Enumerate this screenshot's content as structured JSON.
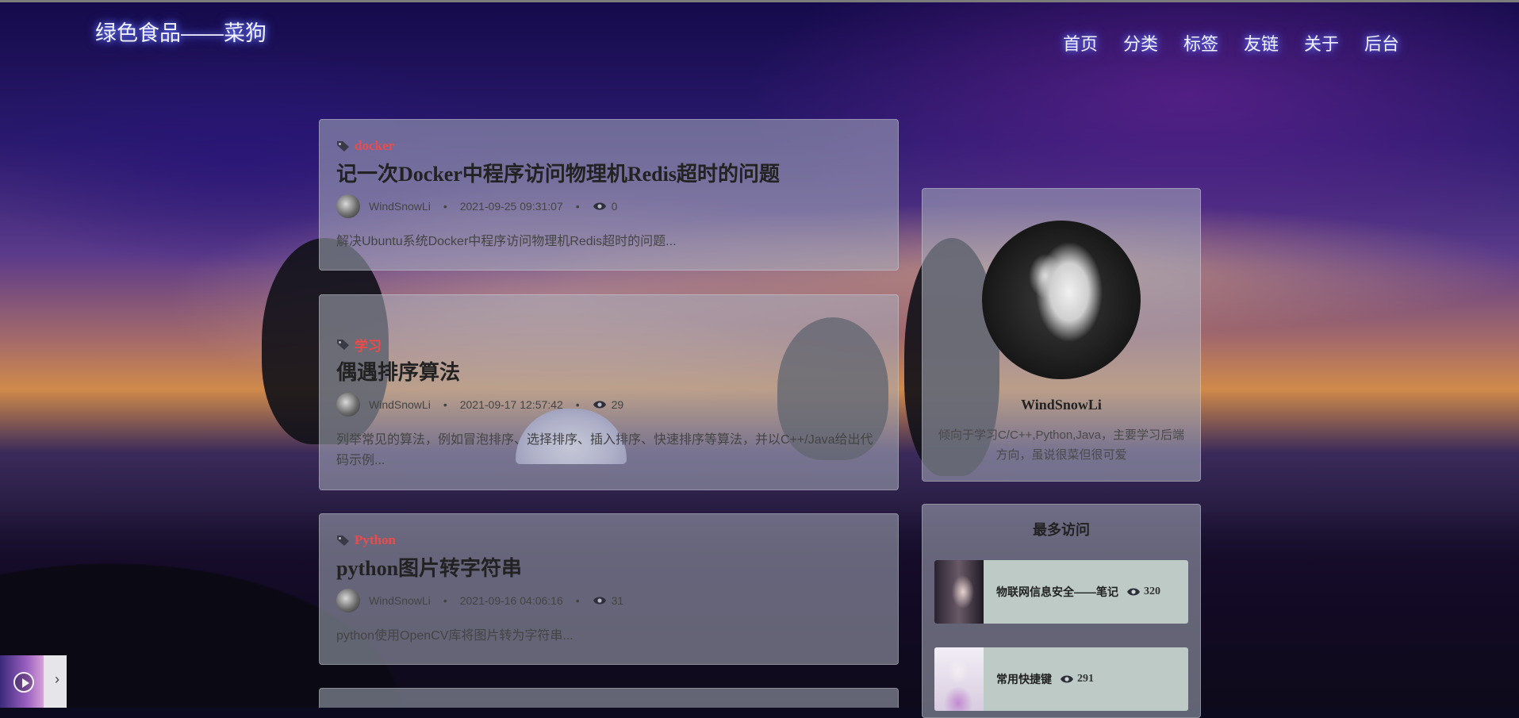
{
  "site": {
    "brand": "绿色食品——菜狗"
  },
  "nav": [
    "首页",
    "分类",
    "标签",
    "友链",
    "关于",
    "后台"
  ],
  "posts": [
    {
      "tag": "docker",
      "title": "记一次Docker中程序访问物理机Redis超时的问题",
      "author": "WindSnowLi",
      "date": "2021-09-25 09:31:07",
      "views": "0",
      "summary": "解决Ubuntu系统Docker中程序访问物理机Redis超时的问题..."
    },
    {
      "tag": "学习",
      "title": "偶遇排序算法",
      "author": "WindSnowLi",
      "date": "2021-09-17 12:57:42",
      "views": "29",
      "summary": "列举常见的算法，例如冒泡排序、选择排序、插入排序、快速排序等算法，并以C++/Java给出代码示例..."
    },
    {
      "tag": "Python",
      "title": "python图片转字符串",
      "author": "WindSnowLi",
      "date": "2021-09-16 04:06:16",
      "views": "31",
      "summary": "python使用OpenCV库将图片转为字符串..."
    }
  ],
  "profile": {
    "name": "WindSnowLi",
    "bio": "倾向于学习C/C++,Python,Java，主要学习后端方向，虽说很菜但很可爱"
  },
  "popular": {
    "title": "最多访问",
    "items": [
      {
        "label": "物联网信息安全——笔记",
        "views": "320"
      },
      {
        "label": "常用快捷键",
        "views": "291"
      }
    ]
  },
  "colors": {
    "tag": "#ef4a4a",
    "nav_glow": "#6a78ff"
  }
}
